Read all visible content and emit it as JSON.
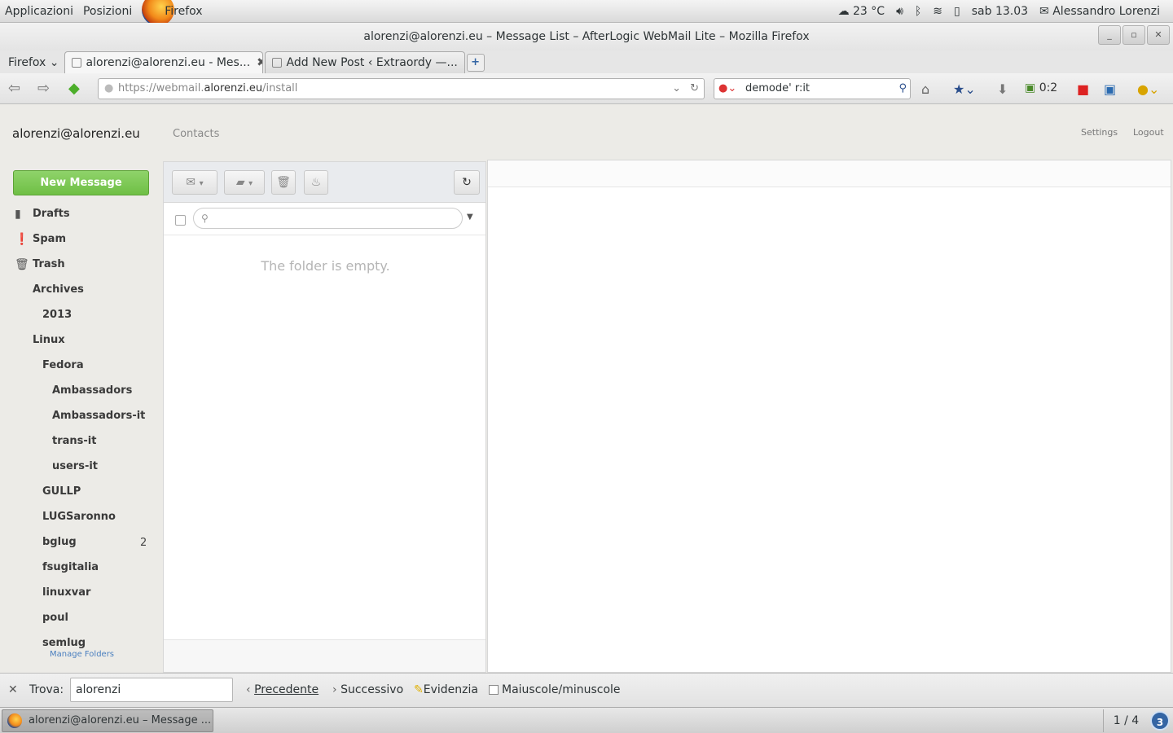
{
  "topbar": {
    "apps": "Applicazioni",
    "places": "Posizioni",
    "firefox": "Firefox",
    "weather": "23 °C",
    "clock": "sab 13.03",
    "user": "Alessandro Lorenzi"
  },
  "window": {
    "title": "alorenzi@alorenzi.eu – Message List – AfterLogic WebMail Lite – Mozilla Firefox"
  },
  "tabs": {
    "menu": "Firefox",
    "items": [
      {
        "label": "alorenzi@alorenzi.eu - Mes..."
      },
      {
        "label": "Add New Post ‹ Extraordy —..."
      }
    ]
  },
  "nav": {
    "url_prefix": "https://webmail.",
    "url_domain": "alorenzi.eu",
    "url_path": "/install",
    "search_value": "demode' r:it",
    "counter": "0:2"
  },
  "app": {
    "account": "alorenzi@alorenzi.eu",
    "contacts": "Contacts",
    "settings": "Settings",
    "logout": "Logout",
    "new_message": "New Message",
    "folders": [
      {
        "label": "Drafts"
      },
      {
        "label": "Spam"
      },
      {
        "label": "Trash"
      },
      {
        "label": "Archives"
      },
      {
        "label": "2013"
      },
      {
        "label": "Linux"
      },
      {
        "label": "Fedora"
      },
      {
        "label": "Ambassadors"
      },
      {
        "label": "Ambassadors-it"
      },
      {
        "label": "trans-it"
      },
      {
        "label": "users-it"
      },
      {
        "label": "GULLP"
      },
      {
        "label": "LUGSaronno"
      },
      {
        "label": "bglug",
        "count": "2"
      },
      {
        "label": "fsugitalia"
      },
      {
        "label": "linuxvar"
      },
      {
        "label": "poul"
      },
      {
        "label": "semlug"
      }
    ],
    "manage_folders": "Manage Folders",
    "empty_text": "The folder is empty."
  },
  "findbar": {
    "label": "Trova:",
    "value": "alorenzi",
    "prev": "Precedente",
    "next": "Successivo",
    "highlight": "Evidenzia",
    "case": "Maiuscole/minuscole"
  },
  "taskbar": {
    "task": "alorenzi@alorenzi.eu – Message ...",
    "pager": "1 / 4",
    "notifications": "3"
  }
}
